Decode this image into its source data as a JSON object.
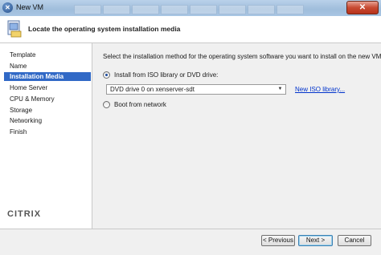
{
  "window": {
    "title": "New VM"
  },
  "header": {
    "title": "Locate the operating system installation media"
  },
  "nav": {
    "items": [
      {
        "label": "Template",
        "selected": false
      },
      {
        "label": "Name",
        "selected": false
      },
      {
        "label": "Installation Media",
        "selected": true
      },
      {
        "label": "Home Server",
        "selected": false
      },
      {
        "label": "CPU & Memory",
        "selected": false
      },
      {
        "label": "Storage",
        "selected": false
      },
      {
        "label": "Networking",
        "selected": false
      },
      {
        "label": "Finish",
        "selected": false
      }
    ],
    "logo_text": "CITRIX"
  },
  "main": {
    "instructions": "Select the installation method for the operating system software you want to install on the new VM.",
    "option_iso": {
      "label": "Install from ISO library or DVD drive:",
      "checked": true
    },
    "iso_select": {
      "value": "DVD drive 0 on xenserver-sdt"
    },
    "new_iso_link": "New ISO library...",
    "option_network": {
      "label": "Boot from network",
      "checked": false
    }
  },
  "footer": {
    "previous_label": "< Previous",
    "next_label": "Next >",
    "cancel_label": "Cancel"
  },
  "colors": {
    "selection": "#3169c6",
    "link": "#0033cc",
    "close_button": "#c74a32"
  }
}
